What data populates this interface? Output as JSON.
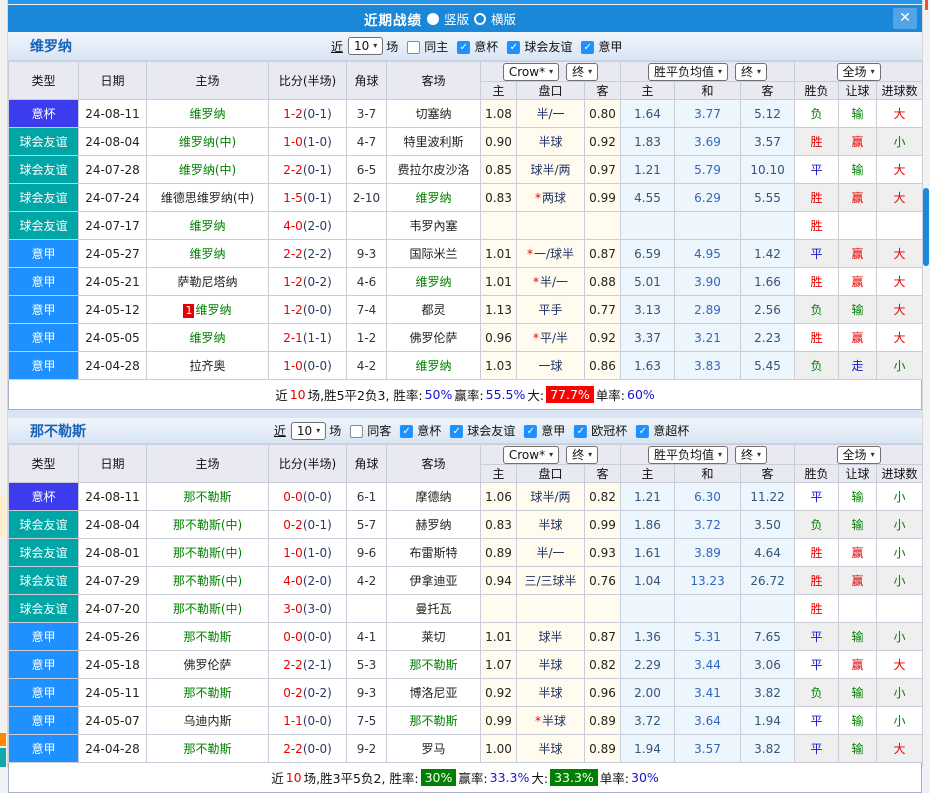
{
  "window": {
    "title": "近期战绩",
    "layout_vertical": "竖版",
    "layout_horizontal": "横版",
    "close_label": "✕"
  },
  "table_header": {
    "type": "类型",
    "date": "日期",
    "home": "主场",
    "score": "比分(半场)",
    "corner": "角球",
    "away": "客场",
    "h_home": "主",
    "handicap": "盘口",
    "h_away": "客",
    "a_home": "主",
    "a_draw": "和",
    "a_away": "客",
    "result": "胜负",
    "let_ball": "让球",
    "goals": "进球数",
    "odds_source": "Crow*",
    "final_label": "终",
    "avg_label": "胜平负均值",
    "scope_label": "全场"
  },
  "colors": {
    "titlebar": "#1a87d9",
    "type": {
      "意杯": "#3c3cee",
      "球会友谊": "#00a6a6",
      "意甲": "#1e90ff"
    },
    "result": {
      "win": "#e60000",
      "draw": "#1414cc",
      "lose": "#008000"
    },
    "team_green": "#008000",
    "score_red": "#e60000",
    "half_navy": "#2b3a66",
    "highlight_red": "#ff0000",
    "highlight_green": "#008000"
  },
  "sections": [
    {
      "team": "维罗纳",
      "filters": {
        "near": "近",
        "count": "10",
        "games": "场",
        "same": "同主",
        "same_checked": false,
        "comps": [
          {
            "label": "意杯",
            "checked": true
          },
          {
            "label": "球会友谊",
            "checked": true
          },
          {
            "label": "意甲",
            "checked": true
          }
        ]
      },
      "rows": [
        {
          "t": "意杯",
          "d": "24-08-11",
          "h": "维罗纳",
          "hg": true,
          "rc": "",
          "s": "1-2",
          "sh": "(0-1)",
          "ck": "3-7",
          "a": "切塞纳",
          "ag": false,
          "o1": "1.08",
          "st": false,
          "hc": "半/一",
          "o2": "0.80",
          "m1": "1.64",
          "m2": "3.77",
          "m3": "5.12",
          "r1": "负",
          "r2": "输",
          "r3": "大"
        },
        {
          "t": "球会友谊",
          "d": "24-08-04",
          "h": "维罗纳(中)",
          "hg": true,
          "rc": "",
          "s": "1-0",
          "sh": "(1-0)",
          "ck": "4-7",
          "a": "特里波利斯",
          "ag": false,
          "o1": "0.90",
          "st": false,
          "hc": "半球",
          "o2": "0.92",
          "m1": "1.83",
          "m2": "3.69",
          "m3": "3.57",
          "r1": "胜",
          "r2": "赢",
          "r3": "小"
        },
        {
          "t": "球会友谊",
          "d": "24-07-28",
          "h": "维罗纳(中)",
          "hg": true,
          "rc": "",
          "s": "2-2",
          "sh": "(0-1)",
          "ck": "6-5",
          "a": "费拉尔皮沙洛",
          "ag": false,
          "o1": "0.85",
          "st": false,
          "hc": "球半/两",
          "o2": "0.97",
          "m1": "1.21",
          "m2": "5.79",
          "m3": "10.10",
          "r1": "平",
          "r2": "输",
          "r3": "大"
        },
        {
          "t": "球会友谊",
          "d": "24-07-24",
          "h": "维德思维罗纳(中)",
          "hg": false,
          "rc": "",
          "s": "1-5",
          "sh": "(0-1)",
          "ck": "2-10",
          "a": "维罗纳",
          "ag": true,
          "o1": "0.83",
          "st": true,
          "hc": "两球",
          "o2": "0.99",
          "m1": "4.55",
          "m2": "6.29",
          "m3": "5.55",
          "r1": "胜",
          "r2": "赢",
          "r3": "大"
        },
        {
          "t": "球会友谊",
          "d": "24-07-17",
          "h": "维罗纳",
          "hg": true,
          "rc": "",
          "s": "4-0",
          "sh": "(2-0)",
          "ck": "",
          "a": "韦罗內塞",
          "ag": false,
          "o1": "",
          "st": false,
          "hc": "",
          "o2": "",
          "m1": "",
          "m2": "",
          "m3": "",
          "r1": "胜",
          "r2": "",
          "r3": ""
        },
        {
          "t": "意甲",
          "d": "24-05-27",
          "h": "维罗纳",
          "hg": true,
          "rc": "",
          "s": "2-2",
          "sh": "(2-2)",
          "ck": "9-3",
          "a": "国际米兰",
          "ag": false,
          "o1": "1.01",
          "st": true,
          "hc": "一/球半",
          "o2": "0.87",
          "m1": "6.59",
          "m2": "4.95",
          "m3": "1.42",
          "r1": "平",
          "r2": "赢",
          "r3": "大"
        },
        {
          "t": "意甲",
          "d": "24-05-21",
          "h": "萨勒尼塔纳",
          "hg": false,
          "rc": "",
          "s": "1-2",
          "sh": "(0-2)",
          "ck": "4-6",
          "a": "维罗纳",
          "ag": true,
          "o1": "1.01",
          "st": true,
          "hc": "半/一",
          "o2": "0.88",
          "m1": "5.01",
          "m2": "3.90",
          "m3": "1.66",
          "r1": "胜",
          "r2": "赢",
          "r3": "大"
        },
        {
          "t": "意甲",
          "d": "24-05-12",
          "h": "维罗纳",
          "hg": true,
          "rc": "1",
          "s": "1-2",
          "sh": "(0-0)",
          "ck": "7-4",
          "a": "都灵",
          "ag": false,
          "o1": "1.13",
          "st": false,
          "hc": "平手",
          "o2": "0.77",
          "m1": "3.13",
          "m2": "2.89",
          "m3": "2.56",
          "r1": "负",
          "r2": "输",
          "r3": "大"
        },
        {
          "t": "意甲",
          "d": "24-05-05",
          "h": "维罗纳",
          "hg": true,
          "rc": "",
          "s": "2-1",
          "sh": "(1-1)",
          "ck": "1-2",
          "a": "佛罗伦萨",
          "ag": false,
          "o1": "0.96",
          "st": true,
          "hc": "平/半",
          "o2": "0.92",
          "m1": "3.37",
          "m2": "3.21",
          "m3": "2.23",
          "r1": "胜",
          "r2": "赢",
          "r3": "大"
        },
        {
          "t": "意甲",
          "d": "24-04-28",
          "h": "拉齐奥",
          "hg": false,
          "rc": "",
          "s": "1-0",
          "sh": "(0-0)",
          "ck": "4-2",
          "a": "维罗纳",
          "ag": true,
          "o1": "1.03",
          "st": false,
          "hc": "一球",
          "o2": "0.86",
          "m1": "1.63",
          "m2": "3.83",
          "m3": "5.45",
          "r1": "负",
          "r2": "走",
          "r3": "小"
        }
      ],
      "summary": [
        {
          "t": "近",
          "c": ""
        },
        {
          "t": "10",
          "c": "red"
        },
        {
          "t": "场,胜5平2负3, 胜率:",
          "c": ""
        },
        {
          "t": "50%",
          "c": "blue"
        },
        {
          "t": " 赢率:",
          "c": ""
        },
        {
          "t": "55.5%",
          "c": "blue"
        },
        {
          "t": " 大:",
          "c": ""
        },
        {
          "t": "77.7%",
          "c": "redbg"
        },
        {
          "t": " 单率:",
          "c": ""
        },
        {
          "t": "60%",
          "c": "blue"
        }
      ]
    },
    {
      "team": "那不勒斯",
      "filters": {
        "near": "近",
        "count": "10",
        "games": "场",
        "same": "同客",
        "same_checked": false,
        "comps": [
          {
            "label": "意杯",
            "checked": true
          },
          {
            "label": "球会友谊",
            "checked": true
          },
          {
            "label": "意甲",
            "checked": true
          },
          {
            "label": "欧冠杯",
            "checked": true
          },
          {
            "label": "意超杯",
            "checked": true
          }
        ]
      },
      "rows": [
        {
          "t": "意杯",
          "d": "24-08-11",
          "h": "那不勒斯",
          "hg": true,
          "rc": "",
          "s": "0-0",
          "sh": "(0-0)",
          "ck": "6-1",
          "a": "摩德纳",
          "ag": false,
          "o1": "1.06",
          "st": false,
          "hc": "球半/两",
          "o2": "0.82",
          "m1": "1.21",
          "m2": "6.30",
          "m3": "11.22",
          "r1": "平",
          "r2": "输",
          "r3": "小"
        },
        {
          "t": "球会友谊",
          "d": "24-08-04",
          "h": "那不勒斯(中)",
          "hg": true,
          "rc": "",
          "s": "0-2",
          "sh": "(0-1)",
          "ck": "5-7",
          "a": "赫罗纳",
          "ag": false,
          "o1": "0.83",
          "st": false,
          "hc": "半球",
          "o2": "0.99",
          "m1": "1.86",
          "m2": "3.72",
          "m3": "3.50",
          "r1": "负",
          "r2": "输",
          "r3": "小"
        },
        {
          "t": "球会友谊",
          "d": "24-08-01",
          "h": "那不勒斯(中)",
          "hg": true,
          "rc": "",
          "s": "1-0",
          "sh": "(1-0)",
          "ck": "9-6",
          "a": "布雷斯特",
          "ag": false,
          "o1": "0.89",
          "st": false,
          "hc": "半/一",
          "o2": "0.93",
          "m1": "1.61",
          "m2": "3.89",
          "m3": "4.64",
          "r1": "胜",
          "r2": "赢",
          "r3": "小"
        },
        {
          "t": "球会友谊",
          "d": "24-07-29",
          "h": "那不勒斯(中)",
          "hg": true,
          "rc": "",
          "s": "4-0",
          "sh": "(2-0)",
          "ck": "4-2",
          "a": "伊拿迪亚",
          "ag": false,
          "o1": "0.94",
          "st": false,
          "hc": "三/三球半",
          "o2": "0.76",
          "m1": "1.04",
          "m2": "13.23",
          "m3": "26.72",
          "r1": "胜",
          "r2": "赢",
          "r3": "小"
        },
        {
          "t": "球会友谊",
          "d": "24-07-20",
          "h": "那不勒斯(中)",
          "hg": true,
          "rc": "",
          "s": "3-0",
          "sh": "(3-0)",
          "ck": "",
          "a": "曼托瓦",
          "ag": false,
          "o1": "",
          "st": false,
          "hc": "",
          "o2": "",
          "m1": "",
          "m2": "",
          "m3": "",
          "r1": "胜",
          "r2": "",
          "r3": ""
        },
        {
          "t": "意甲",
          "d": "24-05-26",
          "h": "那不勒斯",
          "hg": true,
          "rc": "",
          "s": "0-0",
          "sh": "(0-0)",
          "ck": "4-1",
          "a": "莱切",
          "ag": false,
          "o1": "1.01",
          "st": false,
          "hc": "球半",
          "o2": "0.87",
          "m1": "1.36",
          "m2": "5.31",
          "m3": "7.65",
          "r1": "平",
          "r2": "输",
          "r3": "小"
        },
        {
          "t": "意甲",
          "d": "24-05-18",
          "h": "佛罗伦萨",
          "hg": false,
          "rc": "",
          "s": "2-2",
          "sh": "(2-1)",
          "ck": "5-3",
          "a": "那不勒斯",
          "ag": true,
          "o1": "1.07",
          "st": false,
          "hc": "半球",
          "o2": "0.82",
          "m1": "2.29",
          "m2": "3.44",
          "m3": "3.06",
          "r1": "平",
          "r2": "赢",
          "r3": "大"
        },
        {
          "t": "意甲",
          "d": "24-05-11",
          "h": "那不勒斯",
          "hg": true,
          "rc": "",
          "s": "0-2",
          "sh": "(0-2)",
          "ck": "9-3",
          "a": "博洛尼亚",
          "ag": false,
          "o1": "0.92",
          "st": false,
          "hc": "半球",
          "o2": "0.96",
          "m1": "2.00",
          "m2": "3.41",
          "m3": "3.82",
          "r1": "负",
          "r2": "输",
          "r3": "小"
        },
        {
          "t": "意甲",
          "d": "24-05-07",
          "h": "乌迪内斯",
          "hg": false,
          "rc": "",
          "s": "1-1",
          "sh": "(0-0)",
          "ck": "7-5",
          "a": "那不勒斯",
          "ag": true,
          "o1": "0.99",
          "st": true,
          "hc": "半球",
          "o2": "0.89",
          "m1": "3.72",
          "m2": "3.64",
          "m3": "1.94",
          "r1": "平",
          "r2": "输",
          "r3": "小"
        },
        {
          "t": "意甲",
          "d": "24-04-28",
          "h": "那不勒斯",
          "hg": true,
          "rc": "",
          "s": "2-2",
          "sh": "(0-0)",
          "ck": "9-2",
          "a": "罗马",
          "ag": false,
          "o1": "1.00",
          "st": false,
          "hc": "半球",
          "o2": "0.89",
          "m1": "1.94",
          "m2": "3.57",
          "m3": "3.82",
          "r1": "平",
          "r2": "输",
          "r3": "大"
        }
      ],
      "summary": [
        {
          "t": "近",
          "c": ""
        },
        {
          "t": "10",
          "c": "red"
        },
        {
          "t": "场,胜3平5负2, 胜率:",
          "c": ""
        },
        {
          "t": "30%",
          "c": "greenbg"
        },
        {
          "t": " 赢率:",
          "c": ""
        },
        {
          "t": "33.3%",
          "c": "blue"
        },
        {
          "t": " 大:",
          "c": ""
        },
        {
          "t": "33.3%",
          "c": "greenbg"
        },
        {
          "t": " 单率:",
          "c": ""
        },
        {
          "t": "30%",
          "c": "blue"
        }
      ]
    }
  ]
}
